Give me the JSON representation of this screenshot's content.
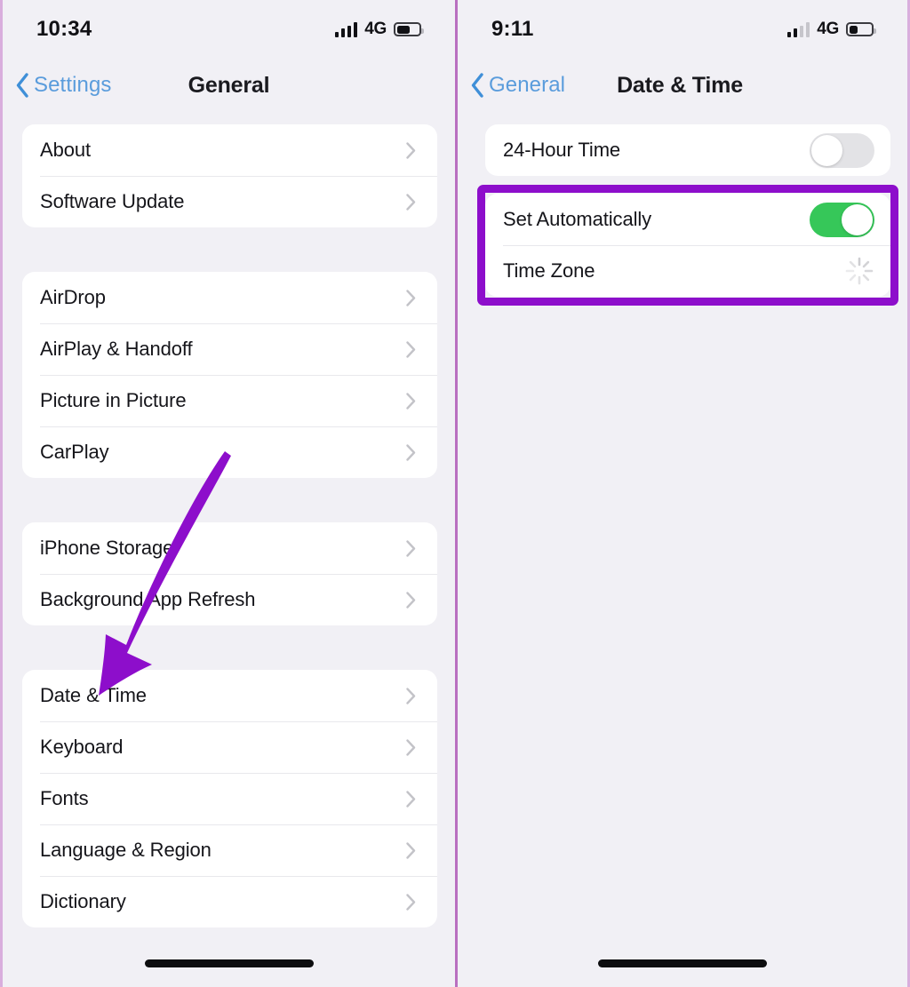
{
  "theme": {
    "screen_bg": "#f1f0f5",
    "card_bg": "#ffffff",
    "accent_link": "#5a9cdc",
    "toggle_on": "#36c759",
    "toggle_off": "#e3e3e6",
    "annotation_purple": "#8d0ecb",
    "chevron_gray": "#c7c7cc",
    "divider": "#d9aedd"
  },
  "panels": [
    {
      "id": "general-settings",
      "status_bar": {
        "clock": "10:34",
        "network_label": "4G",
        "signal_bars_filled": 4,
        "signal_bars_total": 4,
        "battery_percent": 60,
        "icons": [
          "cellular-signal-icon",
          "battery-icon"
        ]
      },
      "nav": {
        "back_label": "Settings",
        "back_icon": "chevron-left-icon",
        "title": "General"
      },
      "groups": [
        {
          "rows": [
            {
              "label": "About",
              "accessory": "chevron-right-icon"
            },
            {
              "label": "Software Update",
              "accessory": "chevron-right-icon"
            }
          ]
        },
        {
          "rows": [
            {
              "label": "AirDrop",
              "accessory": "chevron-right-icon"
            },
            {
              "label": "AirPlay & Handoff",
              "accessory": "chevron-right-icon"
            },
            {
              "label": "Picture in Picture",
              "accessory": "chevron-right-icon"
            },
            {
              "label": "CarPlay",
              "accessory": "chevron-right-icon"
            }
          ]
        },
        {
          "rows": [
            {
              "label": "iPhone Storage",
              "accessory": "chevron-right-icon"
            },
            {
              "label": "Background App Refresh",
              "accessory": "chevron-right-icon"
            }
          ]
        },
        {
          "rows": [
            {
              "label": "Date & Time",
              "accessory": "chevron-right-icon"
            },
            {
              "label": "Keyboard",
              "accessory": "chevron-right-icon"
            },
            {
              "label": "Fonts",
              "accessory": "chevron-right-icon"
            },
            {
              "label": "Language & Region",
              "accessory": "chevron-right-icon"
            },
            {
              "label": "Dictionary",
              "accessory": "chevron-right-icon"
            }
          ]
        }
      ],
      "annotation": {
        "type": "arrow",
        "color": "#8d0ecb",
        "points_to": "Date & Time"
      }
    },
    {
      "id": "date-and-time",
      "status_bar": {
        "clock": "9:11",
        "network_label": "4G",
        "signal_bars_filled": 2,
        "signal_bars_total": 4,
        "battery_percent": 40,
        "icons": [
          "cellular-signal-icon",
          "battery-icon"
        ]
      },
      "nav": {
        "back_label": "General",
        "back_icon": "chevron-left-icon",
        "title": "Date & Time"
      },
      "groups": [
        {
          "rows": [
            {
              "label": "24-Hour Time",
              "accessory": "toggle-switch",
              "toggle_state": "off"
            }
          ]
        },
        {
          "rows": [
            {
              "label": "Set Automatically",
              "accessory": "toggle-switch",
              "toggle_state": "on",
              "highlighted": true
            },
            {
              "label": "Time Zone",
              "accessory": "activity-spinner-icon"
            }
          ]
        }
      ],
      "annotation": {
        "type": "rectangle-highlight",
        "color": "#8d0ecb",
        "surrounds": "Set Automatically"
      }
    }
  ]
}
